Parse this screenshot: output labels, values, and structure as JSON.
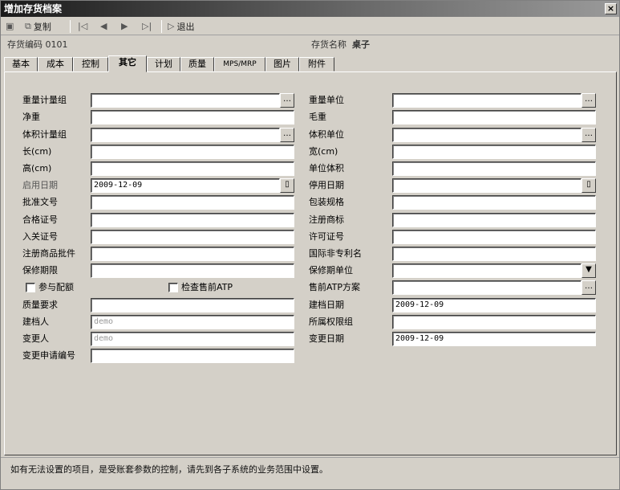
{
  "window": {
    "title": "增加存货档案",
    "close": "×"
  },
  "toolbar": {
    "copy_label": "复制",
    "exit_label": "退出"
  },
  "info": {
    "code_label": "存货编码 0101",
    "name_label": "存货名称",
    "name_value": "桌子"
  },
  "tabs": [
    "基本",
    "成本",
    "控制",
    "其它",
    "计划",
    "质量",
    "MPS/MRP",
    "图片",
    "附件"
  ],
  "form": {
    "weight_group_label": "重量计量组",
    "net_weight_label": "净重",
    "volume_group_label": "体积计量组",
    "length_label": "长(cm)",
    "height_label": "高(cm)",
    "start_date_label": "启用日期",
    "start_date_value": "2009-12-09",
    "approval_no_label": "批准文号",
    "certificate_label": "合格证号",
    "customs_label": "入关证号",
    "registered_item_label": "注册商品批件",
    "warranty_label": "保修期限",
    "matching_label": "参与配额",
    "check_atp_label": "检查售前ATP",
    "quality_req_label": "质量要求",
    "creator_label": "建档人",
    "creator_value": "demo",
    "modifier_label": "变更人",
    "modifier_value": "demo",
    "change_no_label": "变更申请编号",
    "weight_unit_label": "重量单位",
    "gross_weight_label": "毛重",
    "volume_unit_label": "体积单位",
    "width_label": "宽(cm)",
    "unit_volume_label": "单位体积",
    "stop_date_label": "停用日期",
    "package_label": "包装规格",
    "trademark_label": "注册商标",
    "license_label": "许可证号",
    "intl_name_label": "国际非专利名",
    "warranty_unit_label": "保修期单位",
    "presale_atp_label": "售前ATP方案",
    "create_date_label": "建档日期",
    "create_date_value": "2009-12-09",
    "permission_group_label": "所属权限组",
    "change_date_label": "变更日期",
    "change_date_value": "2009-12-09"
  },
  "status": {
    "text": "如有无法设置的项目，是受账套参数的控制，请先到各子系统的业务范围中设置。"
  }
}
